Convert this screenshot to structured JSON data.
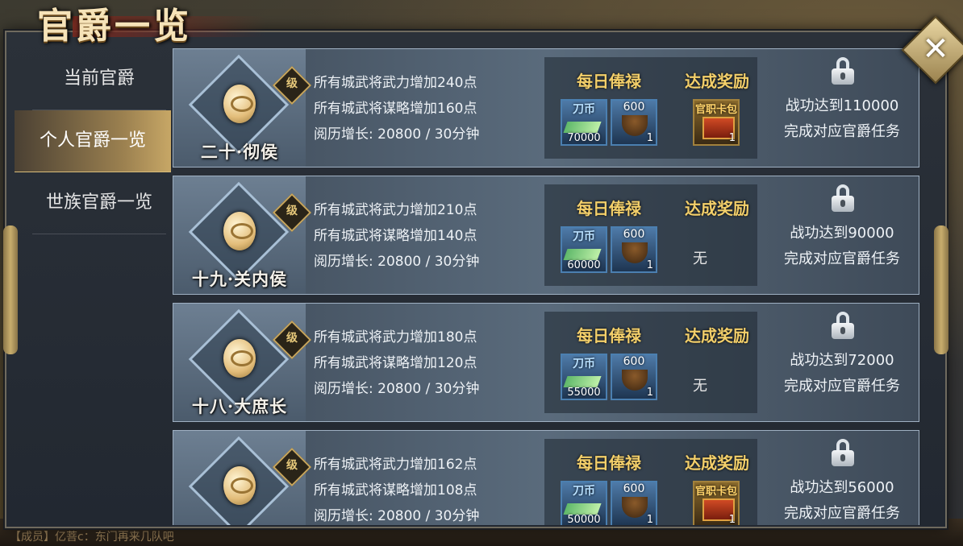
{
  "title": "官爵一览",
  "close_icon": "✕",
  "chat_line": "【成员】亿菩c：东门再来几队吧",
  "sidebar": {
    "items": [
      {
        "label": "当前官爵"
      },
      {
        "label": "个人官爵一览"
      },
      {
        "label": "世族官爵一览"
      }
    ],
    "active_index": 1
  },
  "labels": {
    "daily_salary": "每日俸禄",
    "achieve_reward": "达成奖励",
    "coin_label": "刀币",
    "card_label": "官职卡包",
    "none": "无",
    "badge": "级"
  },
  "ranks": [
    {
      "name": "二十·彻侯",
      "stat1": "所有城武将武力增加240点",
      "stat2": "所有城武将谋略增加160点",
      "stat3": "阅历增长: 20800 / 30分钟",
      "coin": "70000",
      "pot_top": "600",
      "pot_count": "1",
      "card_count": "1",
      "has_card": true,
      "req1": "战功达到110000",
      "req2": "完成对应官爵任务"
    },
    {
      "name": "十九·关内侯",
      "stat1": "所有城武将武力增加210点",
      "stat2": "所有城武将谋略增加140点",
      "stat3": "阅历增长: 20800 / 30分钟",
      "coin": "60000",
      "pot_top": "600",
      "pot_count": "1",
      "has_card": false,
      "req1": "战功达到90000",
      "req2": "完成对应官爵任务"
    },
    {
      "name": "十八·大庶长",
      "stat1": "所有城武将武力增加180点",
      "stat2": "所有城武将谋略增加120点",
      "stat3": "阅历增长: 20800 / 30分钟",
      "coin": "55000",
      "pot_top": "600",
      "pot_count": "1",
      "has_card": false,
      "req1": "战功达到72000",
      "req2": "完成对应官爵任务"
    },
    {
      "name": "",
      "stat1": "所有城武将武力增加162点",
      "stat2": "所有城武将谋略增加108点",
      "stat3": "阅历增长: 20800 / 30分钟",
      "coin": "50000",
      "pot_top": "600",
      "pot_count": "1",
      "card_count": "1",
      "has_card": true,
      "req1": "战功达到56000",
      "req2": "完成对应官爵任务"
    }
  ],
  "colors": {
    "accent_gold": "#f3cf6a",
    "row_bg": "#4e5e70"
  }
}
